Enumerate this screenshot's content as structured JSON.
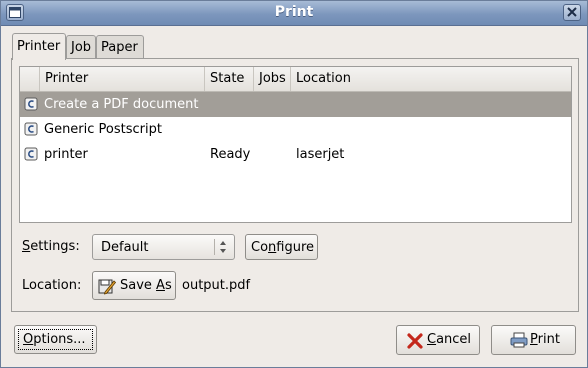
{
  "window": {
    "title": "Print"
  },
  "tabs": [
    {
      "label": "Printer",
      "active": true
    },
    {
      "label": "Job"
    },
    {
      "label": "Paper"
    }
  ],
  "printer_list": {
    "columns": [
      "Printer",
      "State",
      "Jobs",
      "Location"
    ],
    "rows": [
      {
        "icon": "printer-icon",
        "name": "Create a PDF document",
        "state": "",
        "jobs": "",
        "location": "",
        "selected": true
      },
      {
        "icon": "printer-icon",
        "name": "Generic Postscript",
        "state": "",
        "jobs": "",
        "location": ""
      },
      {
        "icon": "printer-icon",
        "name": "printer",
        "state": "Ready",
        "jobs": "",
        "location": "laserjet"
      }
    ]
  },
  "settings": {
    "label_prefix": "S",
    "label_rest": "ettings:",
    "value": "Default",
    "configure_prefix": "Co",
    "configure_mnemonic": "n",
    "configure_rest": "figure"
  },
  "location": {
    "label": "Location:",
    "save_as_prefix": "Save ",
    "save_as_mnemonic": "A",
    "save_as_rest": "s",
    "filename": "output.pdf"
  },
  "buttons": {
    "options_mnemonic": "O",
    "options_rest": "ptions...",
    "cancel_mnemonic": "C",
    "cancel_rest": "ancel",
    "print_mnemonic": "P",
    "print_rest": "rint"
  },
  "colors": {
    "titlebar": "#7d97bd",
    "selection": "#a29e98",
    "cancel_icon": "#c4281c"
  }
}
